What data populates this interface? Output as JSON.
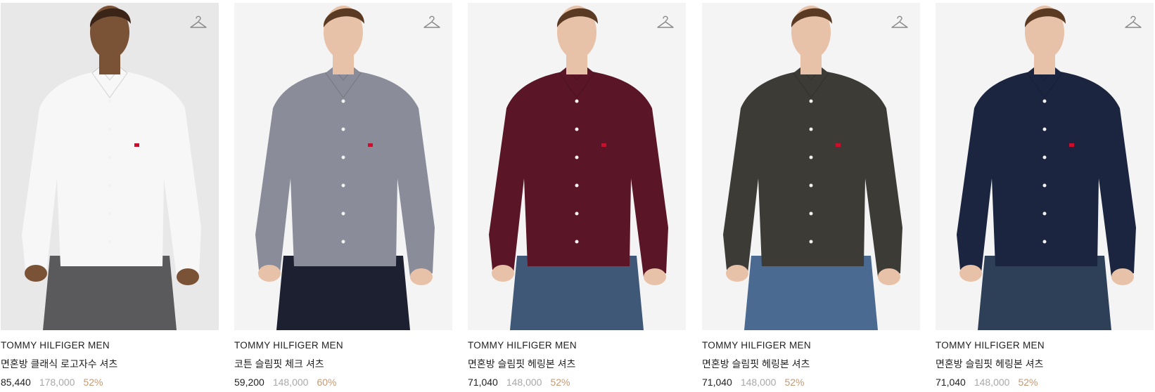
{
  "products": [
    {
      "brand": "TOMMY HILFIGER MEN",
      "name": "면혼방 클래식 로고자수 셔츠",
      "sale_price": "85,440",
      "original_price": "178,000",
      "discount": "52%",
      "shirt_color": "#f7f7f7",
      "pants_color": "#5a5a5c",
      "bg": "#e8e8e8",
      "skin": "#7a5236"
    },
    {
      "brand": "TOMMY HILFIGER MEN",
      "name": "코튼 슬림핏 체크 셔츠",
      "sale_price": "59,200",
      "original_price": "148,000",
      "discount": "60%",
      "shirt_color": "#8a8d99",
      "pants_color": "#1d2030",
      "bg": "#f4f4f4",
      "skin": "#e8c2a8"
    },
    {
      "brand": "TOMMY HILFIGER MEN",
      "name": "면혼방 슬림핏 헤링본 셔츠",
      "sale_price": "71,040",
      "original_price": "148,000",
      "discount": "52%",
      "shirt_color": "#5a1526",
      "pants_color": "#3f5878",
      "bg": "#f4f4f4",
      "skin": "#e8c2a8"
    },
    {
      "brand": "TOMMY HILFIGER MEN",
      "name": "면혼방 슬림핏 헤링본 셔츠",
      "sale_price": "71,040",
      "original_price": "148,000",
      "discount": "52%",
      "shirt_color": "#3c3b36",
      "pants_color": "#4a6a92",
      "bg": "#f4f4f4",
      "skin": "#e8c2a8"
    },
    {
      "brand": "TOMMY HILFIGER MEN",
      "name": "면혼방 슬림핏 헤링본 셔츠",
      "sale_price": "71,040",
      "original_price": "148,000",
      "discount": "52%",
      "shirt_color": "#1c2540",
      "pants_color": "#2e3f58",
      "bg": "#f4f4f4",
      "skin": "#e8c2a8"
    }
  ],
  "icons": {
    "wishlist": "hanger-icon"
  }
}
